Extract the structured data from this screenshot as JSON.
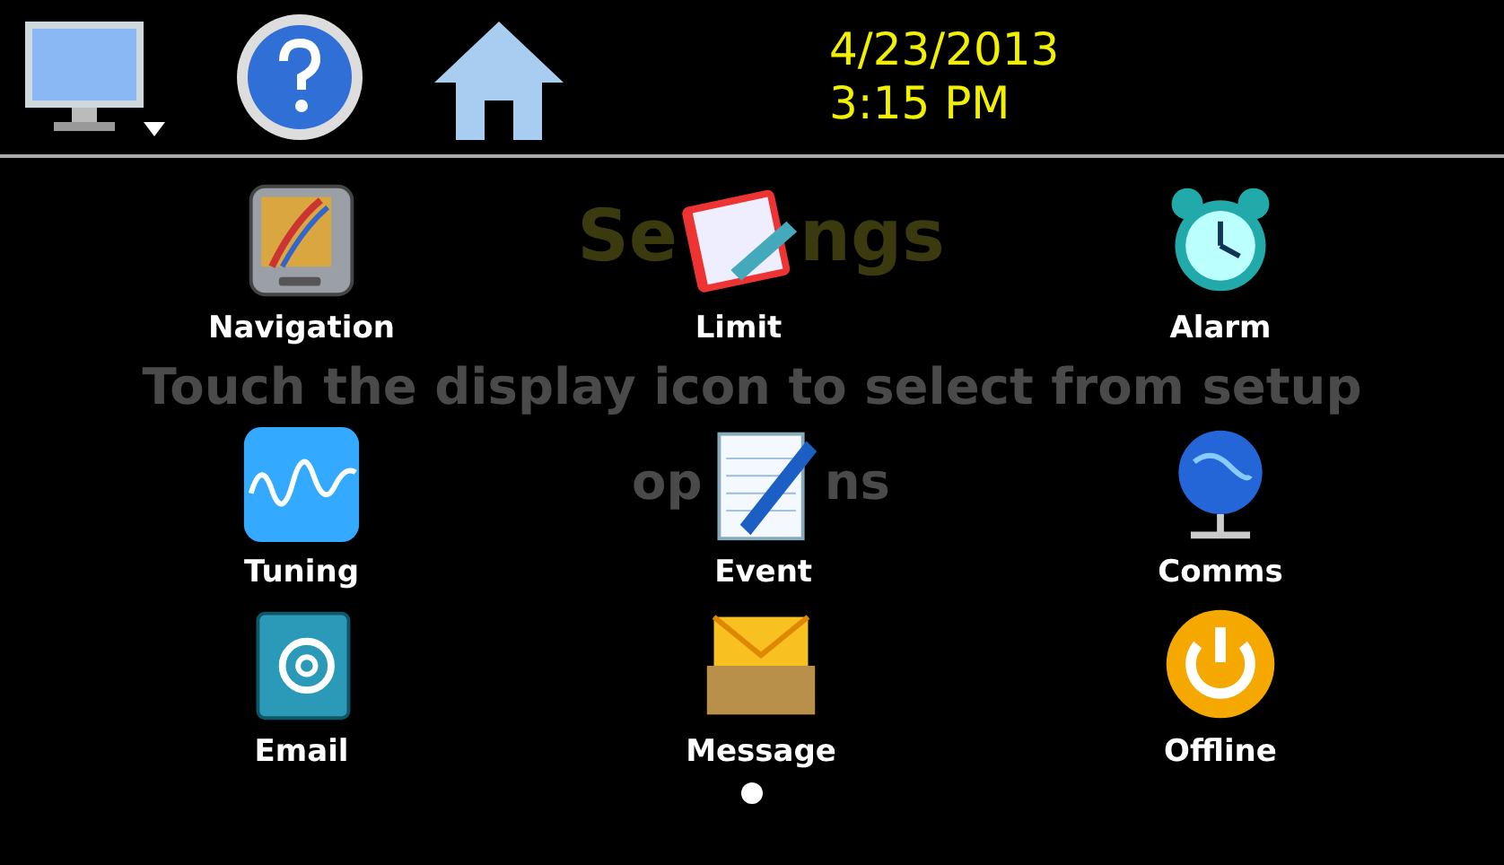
{
  "header": {
    "date": "4/23/2013",
    "time": "3:15 PM"
  },
  "background": {
    "title_parts": [
      "Se",
      "ngs"
    ],
    "subtitle": "Touch the display icon to select from setup",
    "subtitle_parts": [
      "op",
      "ns"
    ]
  },
  "items": [
    {
      "label": "Navigation"
    },
    {
      "label": "Limit"
    },
    {
      "label": "Alarm"
    },
    {
      "label": "Tuning"
    },
    {
      "label": "Event"
    },
    {
      "label": "Comms"
    },
    {
      "label": "Email"
    },
    {
      "label": "Message"
    },
    {
      "label": "Offline"
    }
  ]
}
